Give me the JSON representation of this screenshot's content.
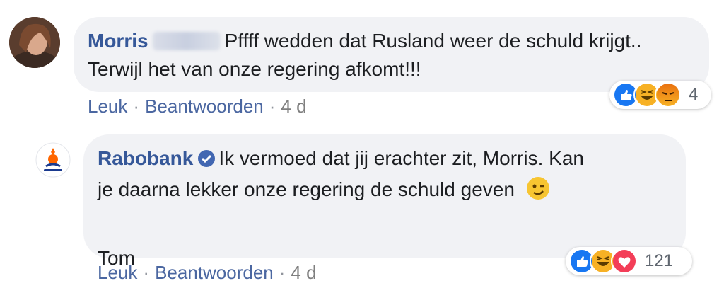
{
  "comment1": {
    "author": "Morris",
    "text_line1": "Pffff wedden dat Rusland weer de schuld krijgt..",
    "text_line2": "Terwijl het van onze regering afkomt!!!",
    "actions": {
      "like": "Leuk",
      "reply": "Beantwoorden",
      "time": "4 d"
    },
    "reactions": {
      "icons": [
        "like-icon",
        "haha-icon",
        "angry-icon"
      ],
      "count": "4"
    }
  },
  "comment2": {
    "author": "Rabobank",
    "text_line1": "Ik vermoed dat jij erachter zit, Morris. Kan",
    "text_line2": "je daarna lekker onze regering de schuld geven",
    "signature": "Tom",
    "actions": {
      "like": "Leuk",
      "reply": "Beantwoorden",
      "time": "4 d"
    },
    "reactions": {
      "icons": [
        "like-icon",
        "haha-icon",
        "love-icon"
      ],
      "count": "121"
    }
  },
  "colors": {
    "bubble": "#f1f2f5",
    "link": "#365899",
    "action_link": "#4b67a1",
    "like": "#1877f2",
    "love": "#f33e58",
    "haha": "#f7b125",
    "angry": "#e9710f"
  }
}
